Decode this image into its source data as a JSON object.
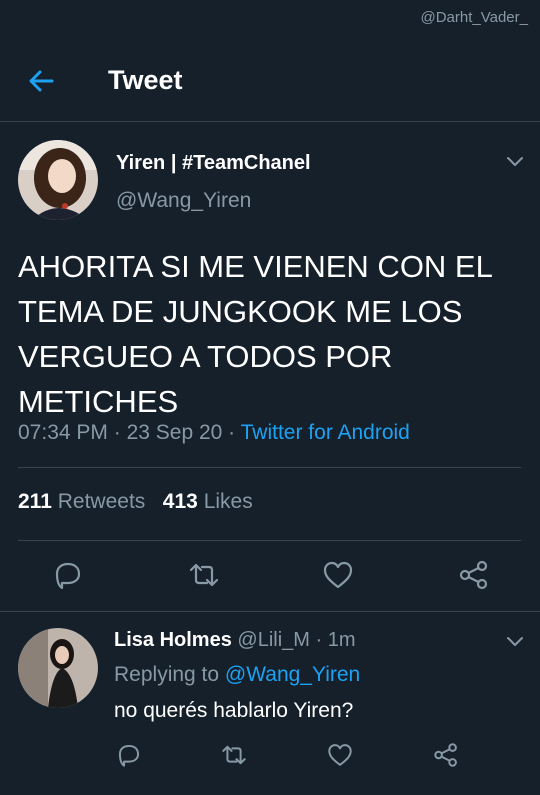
{
  "watermark": "@Darht_Vader_",
  "header": {
    "title": "Tweet"
  },
  "tweet": {
    "author_name": "Yiren | #TeamChanel",
    "author_handle": "@Wang_Yiren",
    "text": "AHORITA SI ME VIENEN CON EL TEMA DE JUNGKOOK ME LOS VERGUEO A TODOS POR METICHES",
    "time": "07:34 PM",
    "date": "23 Sep 20",
    "source": "Twitter for Android",
    "retweets_count": "211",
    "retweets_label": "Retweets",
    "likes_count": "413",
    "likes_label": "Likes"
  },
  "reply": {
    "author_name": "Lisa Holmes",
    "author_handle": "@Lili_M",
    "time": "1m",
    "replying_to_label": "Replying to",
    "replying_to_handle": "@Wang_Yiren",
    "text": "no querés hablarlo Yiren?"
  },
  "colors": {
    "background": "#15202b",
    "accent": "#1da1f2",
    "secondary_text": "#8899a6",
    "divider": "#38444d"
  },
  "icons": [
    "back-arrow-icon",
    "chevron-down-icon",
    "reply-icon",
    "retweet-icon",
    "like-icon",
    "share-icon"
  ]
}
